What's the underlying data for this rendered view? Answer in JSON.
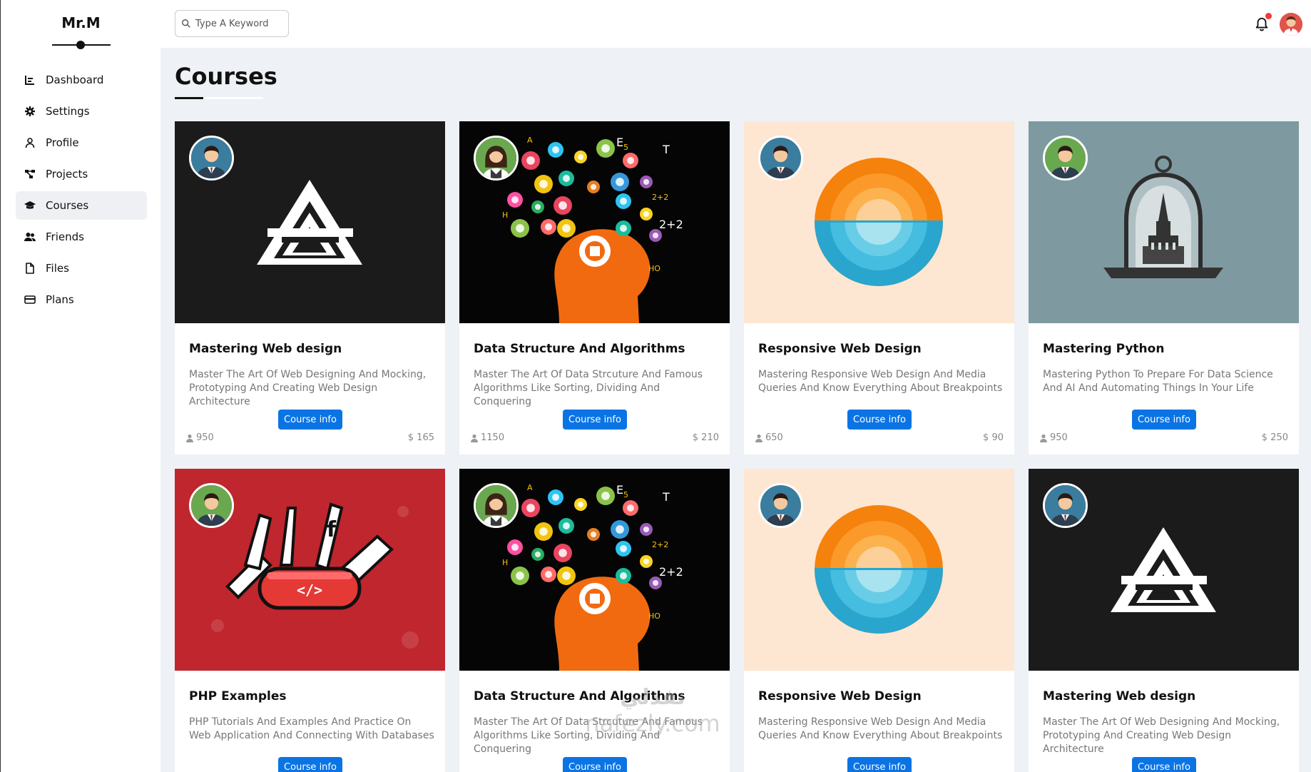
{
  "sidebar": {
    "brand": "Mr.M",
    "items": [
      {
        "label": "Dashboard",
        "icon": "dashboard-icon",
        "active": false
      },
      {
        "label": "Settings",
        "icon": "gear-icon",
        "active": false
      },
      {
        "label": "Profile",
        "icon": "user-icon",
        "active": false
      },
      {
        "label": "Projects",
        "icon": "diagram-icon",
        "active": false
      },
      {
        "label": "Courses",
        "icon": "graduation-cap-icon",
        "active": true
      },
      {
        "label": "Friends",
        "icon": "users-icon",
        "active": false
      },
      {
        "label": "Files",
        "icon": "file-icon",
        "active": false
      },
      {
        "label": "Plans",
        "icon": "credit-card-icon",
        "active": false
      }
    ]
  },
  "header": {
    "search_placeholder": "Type A Keyword",
    "notifications_icon": "bell-icon",
    "has_notification": true
  },
  "main": {
    "title": "Courses",
    "courses": [
      {
        "title": "Mastering Web design",
        "description": "Master The Art Of Web Designing And Mocking, Prototyping And Creating Web Design Architecture",
        "button": "Course info",
        "students": "950",
        "price": "$ 165",
        "image": "web",
        "avatar": "man-blue"
      },
      {
        "title": "Data Structure And Algorithms",
        "description": "Master The Art Of Data Strcuture And Famous Algorithms Like Sorting, Dividing And Conquering",
        "button": "Course info",
        "students": "1150",
        "price": "$ 210",
        "image": "data",
        "avatar": "woman-green"
      },
      {
        "title": "Responsive Web Design",
        "description": "Mastering Responsive Web Design And Media Queries And Know Everything About Breakpoints",
        "button": "Course info",
        "students": "650",
        "price": "$ 90",
        "image": "responsive",
        "avatar": "man-blue"
      },
      {
        "title": "Mastering Python",
        "description": "Mastering Python To Prepare For Data Science And AI And Automating Things In Your Life",
        "button": "Course info",
        "students": "950",
        "price": "$ 250",
        "image": "python",
        "avatar": "man-green"
      },
      {
        "title": "PHP Examples",
        "description": "PHP Tutorials And Examples And Practice On Web Application And Connecting With Databases",
        "button": "Course info",
        "students": "",
        "price": "",
        "image": "php",
        "avatar": "man-green"
      },
      {
        "title": "Data Structure And Algorithms",
        "description": "Master The Art Of Data Strcuture And Famous Algorithms Like Sorting, Dividing And Conquering",
        "button": "Course info",
        "students": "",
        "price": "",
        "image": "data",
        "avatar": "woman-green"
      },
      {
        "title": "Responsive Web Design",
        "description": "Mastering Responsive Web Design And Media Queries And Know Everything About Breakpoints",
        "button": "Course info",
        "students": "",
        "price": "",
        "image": "responsive",
        "avatar": "man-blue"
      },
      {
        "title": "Mastering Web design",
        "description": "Master The Art Of Web Designing And Mocking, Prototyping And Creating Web Design Architecture",
        "button": "Course info",
        "students": "",
        "price": "",
        "image": "web",
        "avatar": "man-blue"
      }
    ]
  },
  "watermark": {
    "text": "نفذلي",
    "sub": "nafezly.com"
  },
  "colors": {
    "accent": "#0b74e5",
    "notification": "#ef3a3a",
    "background": "#eef1f5"
  }
}
